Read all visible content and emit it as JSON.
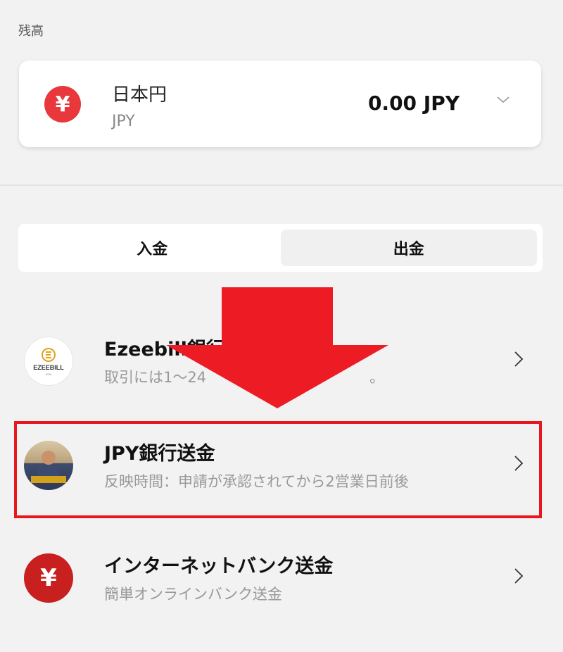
{
  "balance": {
    "label": "残高",
    "currency_name": "日本円",
    "currency_code": "JPY",
    "amount": "0.00 JPY",
    "currency_symbol": "¥"
  },
  "tabs": [
    {
      "label": "入金",
      "active": false
    },
    {
      "label": "出金",
      "active": true
    }
  ],
  "methods": [
    {
      "title": "Ezeebill銀行",
      "desc": "取引には1〜24",
      "desc_tail": "。",
      "icon": "ezeebill-logo",
      "logo_text": "EZEEBILL",
      "logo_sub": "ASIA"
    },
    {
      "title": "JPY銀行送金",
      "desc": "反映時間：申請が承認されてから2営業日前後",
      "icon": "bank-transfer-photo"
    },
    {
      "title": "インターネットバンク送金",
      "desc": "簡単オンラインバンク送金",
      "icon": "yen-icon",
      "icon_symbol": "¥"
    }
  ],
  "annotation": {
    "arrow_color": "#ed1c24",
    "highlight_color": "#e8161f"
  }
}
